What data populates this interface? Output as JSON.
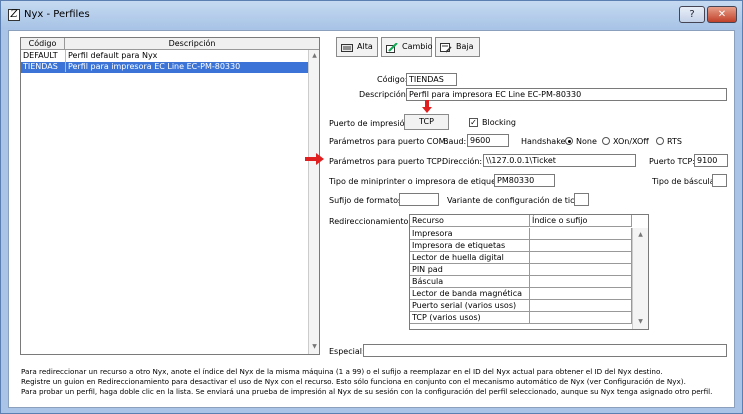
{
  "window": {
    "title": "Nyx - Perfiles",
    "help_label": "?",
    "close_label": "✕"
  },
  "profiles": {
    "columns": [
      "Código",
      "Descripción"
    ],
    "rows": [
      {
        "code": "DEFAULT",
        "description": "Perfil default para Nyx",
        "selected": false
      },
      {
        "code": "TIENDAS",
        "description": "Perfil para impresora EC Line EC-PM-80330",
        "selected": true
      }
    ]
  },
  "toolbar": {
    "alta_label": "Alta",
    "cambio_label": "Cambio",
    "baja_label": "Baja"
  },
  "form": {
    "codigo_label": "Código:",
    "codigo_value": "TIENDAS",
    "descripcion_label": "Descripción:",
    "descripcion_value": "Perfil para impresora EC Line EC-PM-80330",
    "puerto_impresion_label": "Puerto de impresión:",
    "puerto_button_label": "TCP",
    "blocking_label": "Blocking",
    "blocking_checked": true,
    "com_label": "Parámetros para puerto COM:",
    "baud_label": "Baud:",
    "baud_value": "9600",
    "handshake_label": "Handshake:",
    "handshake_options": [
      "None",
      "XOn/XOff",
      "RTS"
    ],
    "handshake_selected": "None",
    "tcp_label": "Parámetros para puerto TCP:",
    "direccion_label": "Dirección:",
    "direccion_value": "\\\\127.0.0.1\\Ticket",
    "puerto_tcp_label": "Puerto TCP:",
    "puerto_tcp_value": "9100",
    "tipo_mini_label": "Tipo de miniprinter o impresora de etiquetas:",
    "tipo_mini_value": "PM80330",
    "tipo_bascula_label": "Tipo de báscula:",
    "tipo_bascula_value": "",
    "sufijo_label": "Sufijo de formatos:",
    "sufijo_value": "",
    "variante_label": "Variante de configuración de ticket:",
    "variante_value": "",
    "redirect_label": "Redireccionamiento:",
    "especial_label": "Especial:",
    "especial_value": ""
  },
  "redirect_table": {
    "columns": [
      "Recurso",
      "Índice o sufijo"
    ],
    "rows": [
      "Impresora",
      "Impresora de etiquetas",
      "Lector de huella digital",
      "PIN pad",
      "Báscula",
      "Lector de banda magnética",
      "Puerto serial (varios usos)",
      "TCP (varios usos)"
    ]
  },
  "help": {
    "line1": "Para redireccionar un recurso a otro Nyx, anote el índice del Nyx de la misma máquina (1 a 99) o el sufijo a reemplazar en el ID del Nyx actual para obtener el ID del Nyx destino.",
    "line2": "Registre un guion en Redireccionamiento para desactivar el uso de Nyx con el recurso. Esto sólo funciona en conjunto con el mecanismo automático de Nyx (ver Configuración de Nyx).",
    "line3": "Para probar un perfil, haga doble clic en la lista. Se enviará una prueba de impresión al Nyx de su sesión con la configuración del perfil seleccionado, aunque su Nyx tenga asignado otro perfil."
  },
  "colors": {
    "selection": "#3b74d6",
    "annotation_arrow": "#e02020",
    "titlebar": "#a7c3e6"
  }
}
